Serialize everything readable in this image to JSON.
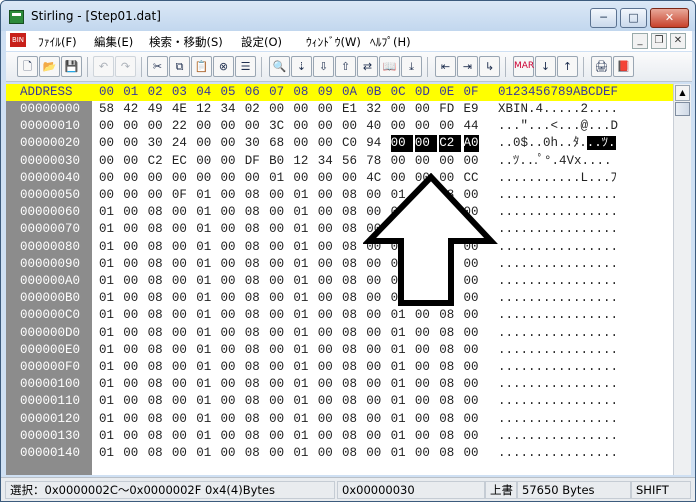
{
  "window": {
    "title": "Stirling - [Step01.dat]"
  },
  "window_buttons": {
    "minimize": "─",
    "maximize": "□",
    "close": "✕"
  },
  "menu": [
    "ﾌｧｲﾙ(F)",
    "編集(E)",
    "検索・移動(S)",
    "設定(O)",
    "ｳｨﾝﾄﾞｳ(W)",
    "ﾍﾙﾌﾟ(H)"
  ],
  "header": {
    "address": "ADDRESS",
    "cols": [
      "00",
      "01",
      "02",
      "03",
      "04",
      "05",
      "06",
      "07",
      "08",
      "09",
      "0A",
      "0B",
      "0C",
      "0D",
      "0E",
      "0F"
    ],
    "ascii": "0123456789ABCDEF"
  },
  "rows": [
    {
      "addr": "00000000",
      "bytes": [
        "58",
        "42",
        "49",
        "4E",
        "12",
        "34",
        "02",
        "00",
        "00",
        "00",
        "E1",
        "32",
        "00",
        "00",
        "FD",
        "E9"
      ],
      "ascii": "XBIN.4.....2...."
    },
    {
      "addr": "00000010",
      "bytes": [
        "00",
        "00",
        "00",
        "22",
        "00",
        "00",
        "00",
        "3C",
        "00",
        "00",
        "00",
        "40",
        "00",
        "00",
        "00",
        "44"
      ],
      "ascii": "...\"...<...@...D"
    },
    {
      "addr": "00000020",
      "bytes": [
        "00",
        "00",
        "30",
        "24",
        "00",
        "00",
        "30",
        "68",
        "00",
        "00",
        "C0",
        "94",
        "00",
        "00",
        "C2",
        "A0"
      ],
      "ascii": "..0$..0h..ﾀ."
    },
    {
      "addr": "00000030",
      "bytes": [
        "00",
        "00",
        "C2",
        "EC",
        "00",
        "00",
        "DF",
        "B0",
        "12",
        "34",
        "56",
        "78",
        "00",
        "00",
        "00",
        "00"
      ],
      "ascii": "..ﾂ...ﾟ°.4Vx...."
    },
    {
      "addr": "00000040",
      "bytes": [
        "00",
        "00",
        "00",
        "00",
        "00",
        "00",
        "00",
        "01",
        "00",
        "00",
        "00",
        "4C",
        "00",
        "00",
        "00",
        "CC"
      ],
      "ascii": "...........L...ﾌ"
    },
    {
      "addr": "00000050",
      "bytes": [
        "00",
        "00",
        "00",
        "0F",
        "01",
        "00",
        "08",
        "00",
        "01",
        "00",
        "08",
        "00",
        "01",
        "00",
        "08",
        "00"
      ],
      "ascii": "................"
    },
    {
      "addr": "00000060",
      "bytes": [
        "01",
        "00",
        "08",
        "00",
        "01",
        "00",
        "08",
        "00",
        "01",
        "00",
        "08",
        "00",
        "01",
        "00",
        "08",
        "00"
      ],
      "ascii": "................"
    },
    {
      "addr": "00000070",
      "bytes": [
        "01",
        "00",
        "08",
        "00",
        "01",
        "00",
        "08",
        "00",
        "01",
        "00",
        "08",
        "00",
        "01",
        "00",
        "08",
        "00"
      ],
      "ascii": "................"
    },
    {
      "addr": "00000080",
      "bytes": [
        "01",
        "00",
        "08",
        "00",
        "01",
        "00",
        "08",
        "00",
        "01",
        "00",
        "08",
        "00",
        "01",
        "00",
        "08",
        "00"
      ],
      "ascii": "................"
    },
    {
      "addr": "00000090",
      "bytes": [
        "01",
        "00",
        "08",
        "00",
        "01",
        "00",
        "08",
        "00",
        "01",
        "00",
        "08",
        "00",
        "01",
        "00",
        "08",
        "00"
      ],
      "ascii": "................"
    },
    {
      "addr": "000000A0",
      "bytes": [
        "01",
        "00",
        "08",
        "00",
        "01",
        "00",
        "08",
        "00",
        "01",
        "00",
        "08",
        "00",
        "01",
        "00",
        "08",
        "00"
      ],
      "ascii": "................"
    },
    {
      "addr": "000000B0",
      "bytes": [
        "01",
        "00",
        "08",
        "00",
        "01",
        "00",
        "08",
        "00",
        "01",
        "00",
        "08",
        "00",
        "01",
        "00",
        "08",
        "00"
      ],
      "ascii": "................"
    },
    {
      "addr": "000000C0",
      "bytes": [
        "01",
        "00",
        "08",
        "00",
        "01",
        "00",
        "08",
        "00",
        "01",
        "00",
        "08",
        "00",
        "01",
        "00",
        "08",
        "00"
      ],
      "ascii": "................"
    },
    {
      "addr": "000000D0",
      "bytes": [
        "01",
        "00",
        "08",
        "00",
        "01",
        "00",
        "08",
        "00",
        "01",
        "00",
        "08",
        "00",
        "01",
        "00",
        "08",
        "00"
      ],
      "ascii": "................"
    },
    {
      "addr": "000000E0",
      "bytes": [
        "01",
        "00",
        "08",
        "00",
        "01",
        "00",
        "08",
        "00",
        "01",
        "00",
        "08",
        "00",
        "01",
        "00",
        "08",
        "00"
      ],
      "ascii": "................"
    },
    {
      "addr": "000000F0",
      "bytes": [
        "01",
        "00",
        "08",
        "00",
        "01",
        "00",
        "08",
        "00",
        "01",
        "00",
        "08",
        "00",
        "01",
        "00",
        "08",
        "00"
      ],
      "ascii": "................"
    },
    {
      "addr": "00000100",
      "bytes": [
        "01",
        "00",
        "08",
        "00",
        "01",
        "00",
        "08",
        "00",
        "01",
        "00",
        "08",
        "00",
        "01",
        "00",
        "08",
        "00"
      ],
      "ascii": "................"
    },
    {
      "addr": "00000110",
      "bytes": [
        "01",
        "00",
        "08",
        "00",
        "01",
        "00",
        "08",
        "00",
        "01",
        "00",
        "08",
        "00",
        "01",
        "00",
        "08",
        "00"
      ],
      "ascii": "................"
    },
    {
      "addr": "00000120",
      "bytes": [
        "01",
        "00",
        "08",
        "00",
        "01",
        "00",
        "08",
        "00",
        "01",
        "00",
        "08",
        "00",
        "01",
        "00",
        "08",
        "00"
      ],
      "ascii": "................"
    },
    {
      "addr": "00000130",
      "bytes": [
        "01",
        "00",
        "08",
        "00",
        "01",
        "00",
        "08",
        "00",
        "01",
        "00",
        "08",
        "00",
        "01",
        "00",
        "08",
        "00"
      ],
      "ascii": "................"
    },
    {
      "addr": "00000140",
      "bytes": [
        "01",
        "00",
        "08",
        "00",
        "01",
        "00",
        "08",
        "00",
        "01",
        "00",
        "08",
        "00",
        "01",
        "00",
        "08",
        "00"
      ],
      "ascii": "................"
    }
  ],
  "selection": {
    "highlight_row": 2,
    "highlight_bytes": [
      12,
      13,
      14,
      15
    ],
    "highlight_ascii_start": 12,
    "ascii_tail": "..ﾂ."
  },
  "status": {
    "selection": "選択：0x0000002C～0x0000002F  0x4(4)Bytes",
    "cursor": "0x00000030",
    "mode": "上書",
    "size": "57650 Bytes",
    "encoding": "SHIFT"
  },
  "colors": {
    "header_bg": "#ffff00",
    "address_bg": "#8c8c8c",
    "selection_bg": "#000000"
  }
}
